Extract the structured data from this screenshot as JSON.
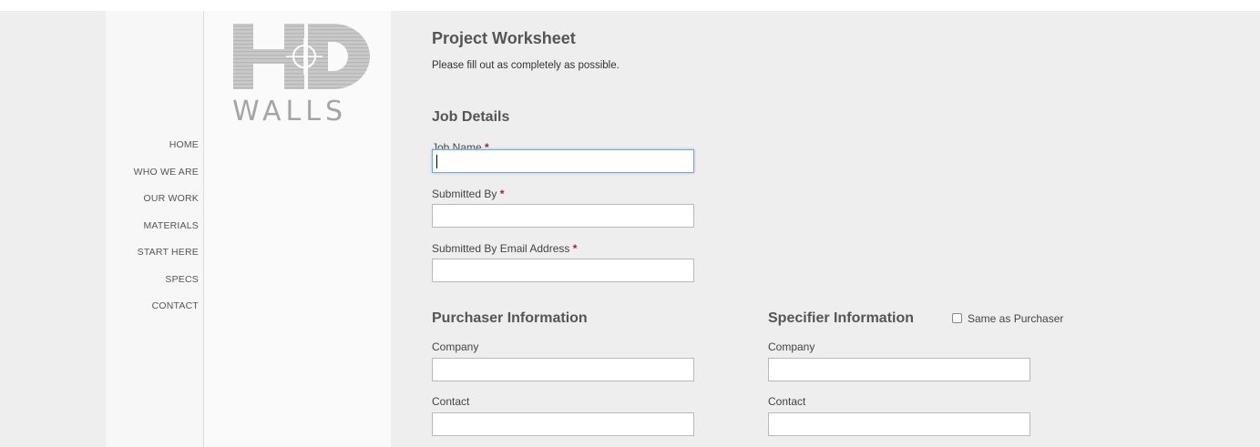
{
  "nav": [
    "HOME",
    "WHO WE ARE",
    "OUR WORK",
    "MATERIALS",
    "START HERE",
    "SPECS",
    "CONTACT"
  ],
  "logo": {
    "text": "WALLS"
  },
  "page": {
    "title": "Project Worksheet",
    "intro": "Please fill out as completely as possible."
  },
  "job": {
    "heading": "Job Details",
    "job_name_label": "Job Name",
    "submitted_by_label": "Submitted By",
    "email_label": "Submitted By Email Address",
    "required_mark": "*"
  },
  "purchaser": {
    "heading": "Purchaser Information",
    "company_label": "Company",
    "contact_label": "Contact"
  },
  "specifier": {
    "heading": "Specifier Information",
    "same_as_label": "Same as Purchaser",
    "company_label": "Company",
    "contact_label": "Contact"
  },
  "colors": {
    "focus": "#79a6e4",
    "required": "#b31b1b",
    "background": "#eeeeee"
  }
}
